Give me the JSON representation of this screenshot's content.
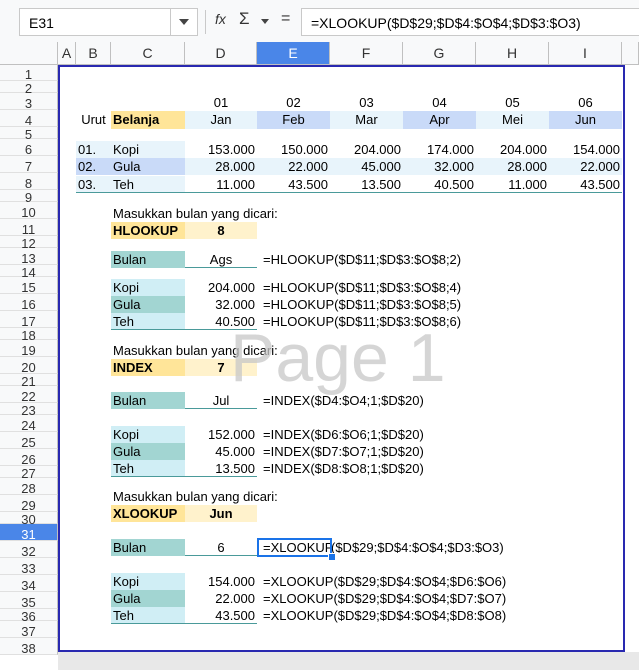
{
  "namebox": {
    "value": "E31"
  },
  "formula_bar": {
    "fx": "fx",
    "sigma": "Σ",
    "equals": "=",
    "formula": "=XLOOKUP($D$29;$D$4:$O$4;$D$3:$O3)"
  },
  "columns": [
    "A",
    "B",
    "C",
    "D",
    "E",
    "F",
    "G",
    "H",
    "I"
  ],
  "rows": [
    "1",
    "2",
    "3",
    "4",
    "5",
    "6",
    "7",
    "8",
    "9",
    "10",
    "11",
    "12",
    "13",
    "14",
    "15",
    "16",
    "17",
    "18",
    "19",
    "20",
    "21",
    "22",
    "23",
    "24",
    "25",
    "26",
    "27",
    "28",
    "29",
    "30",
    "31",
    "32",
    "33",
    "34",
    "35",
    "36",
    "37",
    "38"
  ],
  "header": {
    "nums": [
      "01",
      "02",
      "03",
      "04",
      "05",
      "06"
    ],
    "urut": "Urut",
    "belanja": "Belanja",
    "months": [
      "Jan",
      "Feb",
      "Mar",
      "Apr",
      "Mei",
      "Jun"
    ]
  },
  "table": [
    {
      "no": "01.",
      "item": "Kopi",
      "vals": [
        "153.000",
        "150.000",
        "204.000",
        "174.000",
        "204.000",
        "154.000"
      ]
    },
    {
      "no": "02.",
      "item": "Gula",
      "vals": [
        "28.000",
        "22.000",
        "45.000",
        "32.000",
        "28.000",
        "22.000"
      ]
    },
    {
      "no": "03.",
      "item": "Teh",
      "vals": [
        "11.000",
        "43.500",
        "13.500",
        "40.500",
        "11.000",
        "43.500"
      ]
    }
  ],
  "hlookup": {
    "prompt": "Masukkan bulan yang dicari:",
    "label": "HLOOKUP",
    "value": "8",
    "bulan_label": "Bulan",
    "bulan_val": "Ags",
    "bulan_formula": "=HLOOKUP($D$11;$D$3:$O$8;2)",
    "rows": [
      {
        "item": "Kopi",
        "val": "204.000",
        "formula": "=HLOOKUP($D$11;$D$3:$O$8;4)"
      },
      {
        "item": "Gula",
        "val": "32.000",
        "formula": "=HLOOKUP($D$11;$D$3:$O$8;5)"
      },
      {
        "item": "Teh",
        "val": "40.500",
        "formula": "=HLOOKUP($D$11;$D$3:$O$8;6)"
      }
    ]
  },
  "index": {
    "prompt": "Masukkan bulan yang dicari:",
    "label": "INDEX",
    "value": "7",
    "bulan_label": "Bulan",
    "bulan_val": "Jul",
    "bulan_formula": "=INDEX($D4:$O4;1;$D$20)",
    "rows": [
      {
        "item": "Kopi",
        "val": "152.000",
        "formula": "=INDEX($D6:$O6;1;$D$20)"
      },
      {
        "item": "Gula",
        "val": "45.000",
        "formula": "=INDEX($D7:$O7;1;$D$20)"
      },
      {
        "item": "Teh",
        "val": "13.500",
        "formula": "=INDEX($D8:$O8;1;$D$20)"
      }
    ]
  },
  "xlookup": {
    "prompt": "Masukkan bulan yang dicari:",
    "label": "XLOOKUP",
    "value": "Jun",
    "bulan_label": "Bulan",
    "bulan_val": "6",
    "bulan_formula_a": "=XLOOKUP",
    "bulan_formula_b": "($D$29;$D$4:$O$4;$D3:$O3)",
    "rows": [
      {
        "item": "Kopi",
        "val": "154.000",
        "formula": "=XLOOKUP($D$29;$D$4:$O$4;$D6:$O6)"
      },
      {
        "item": "Gula",
        "val": "22.000",
        "formula": "=XLOOKUP($D$29;$D$4:$O$4;$D7:$O7)"
      },
      {
        "item": "Teh",
        "val": "43.500",
        "formula": "=XLOOKUP($D$29;$D$4:$O$4;$D8:$O8)"
      }
    ]
  },
  "watermark": "Page 1"
}
